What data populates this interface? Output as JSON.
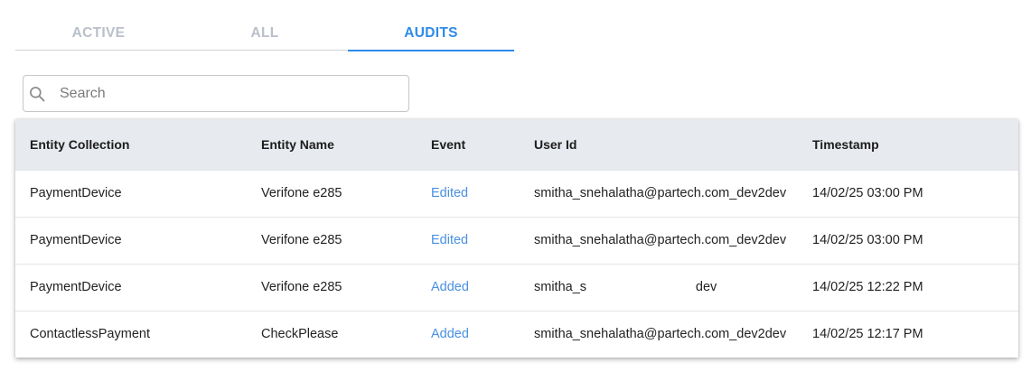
{
  "tabs": [
    {
      "label": "ACTIVE",
      "active": false
    },
    {
      "label": "ALL",
      "active": false
    },
    {
      "label": "AUDITS",
      "active": true
    }
  ],
  "search": {
    "placeholder": "Search",
    "value": "",
    "icon": "search-icon"
  },
  "table": {
    "headers": [
      "Entity Collection",
      "Entity Name",
      "Event",
      "User Id",
      "Timestamp"
    ],
    "rows": [
      {
        "collection": "PaymentDevice",
        "name": "Verifone e285",
        "event": "Edited",
        "user": "smitha_snehalatha@partech.com_dev2dev",
        "timestamp": "14/02/25 03:00 PM"
      },
      {
        "collection": "PaymentDevice",
        "name": "Verifone e285",
        "event": "Edited",
        "user": "smitha_snehalatha@partech.com_dev2dev",
        "timestamp": "14/02/25 03:00 PM"
      },
      {
        "collection": "PaymentDevice",
        "name": "Verifone e285",
        "event": "Added",
        "user": "smitha_s                              dev",
        "timestamp": "14/02/25 12:22 PM"
      },
      {
        "collection": "ContactlessPayment",
        "name": "CheckPlease",
        "event": "Added",
        "user": "smitha_snehalatha@partech.com_dev2dev",
        "timestamp": "14/02/25 12:17 PM"
      }
    ]
  },
  "colors": {
    "accent": "#2e8be8",
    "tab_inactive": "#b9c0c9",
    "header_bg": "#e7eaee",
    "event_link": "#4a90e2"
  }
}
